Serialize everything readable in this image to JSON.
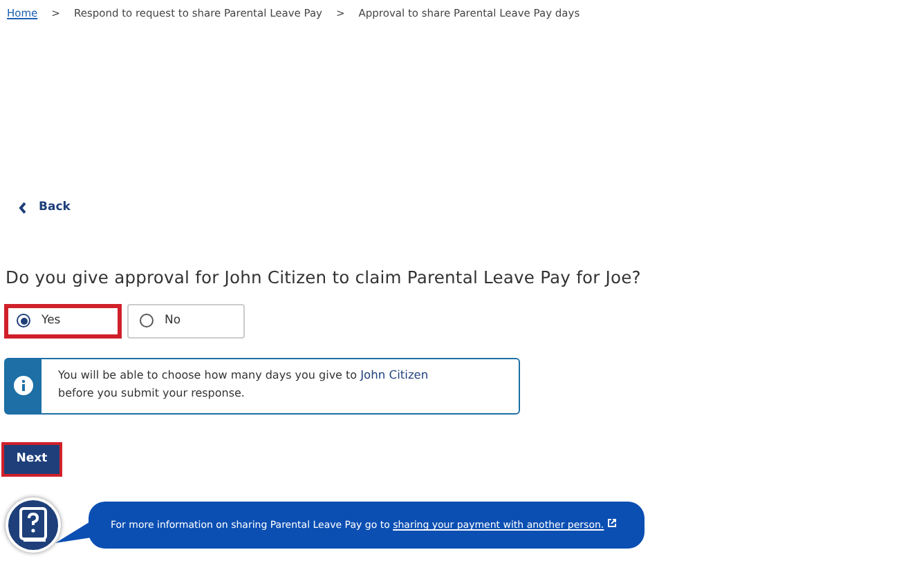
{
  "breadcrumbs": [
    {
      "label": "Home",
      "kind": "link"
    },
    {
      "label": "Respond to request to share Parental Leave Pay",
      "kind": "text"
    },
    {
      "label": "Approval to share Parental Leave Pay days",
      "kind": "text"
    }
  ],
  "breadcrumb_separator": ">",
  "back": {
    "label": "Back"
  },
  "question": "Do you give approval for John Citizen to claim Parental Leave Pay for Joe?",
  "options": [
    {
      "label": "Yes",
      "selected": true,
      "highlighted": true
    },
    {
      "label": "No",
      "selected": false,
      "highlighted": false
    }
  ],
  "info": {
    "before": "You will be able to choose how many days you give to ",
    "name": "John Citizen",
    "after": "before you submit your response."
  },
  "next": {
    "label": "Next",
    "highlighted": true
  },
  "help": {
    "text": "For more information on sharing Parental Leave Pay go to ",
    "link": "sharing your payment with another person."
  }
}
